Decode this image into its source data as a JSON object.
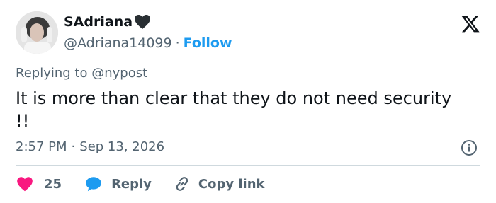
{
  "user": {
    "display_name": "SAdriana",
    "name_emoji": "black-heart",
    "handle": "@Adriana14099",
    "separator": "·",
    "follow_label": "Follow"
  },
  "tweet": {
    "reply_prefix": "Replying to ",
    "reply_mention": "@nypost",
    "text_line1": "It is more than clear that they do not need security",
    "text_line2": "!!",
    "time": "2:57 PM",
    "date": "Sep 13, 2026"
  },
  "actions": {
    "like_count": "25",
    "reply_label": "Reply",
    "copy_label": "Copy link"
  },
  "icons": {
    "brand": "x-logo-icon",
    "info": "info-icon",
    "like": "heart-icon",
    "reply": "comment-bubble-icon",
    "copy": "link-icon"
  },
  "colors": {
    "accent": "#1d9bf0",
    "like": "#f91880",
    "text_primary": "#0f1419",
    "text_secondary": "#536471",
    "divider": "#cfd9de"
  }
}
